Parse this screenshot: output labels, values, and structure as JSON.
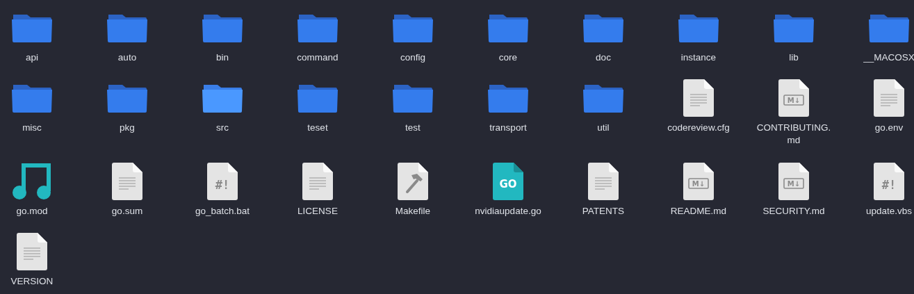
{
  "items": [
    {
      "name": "api",
      "kind": "folder",
      "selected": false
    },
    {
      "name": "auto",
      "kind": "folder",
      "selected": false
    },
    {
      "name": "bin",
      "kind": "folder",
      "selected": false
    },
    {
      "name": "command",
      "kind": "folder",
      "selected": false
    },
    {
      "name": "config",
      "kind": "folder",
      "selected": false
    },
    {
      "name": "core",
      "kind": "folder",
      "selected": false
    },
    {
      "name": "doc",
      "kind": "folder",
      "selected": false
    },
    {
      "name": "instance",
      "kind": "folder",
      "selected": false
    },
    {
      "name": "lib",
      "kind": "folder",
      "selected": false
    },
    {
      "name": "__MACOSX",
      "kind": "folder",
      "selected": false
    },
    {
      "name": "misc",
      "kind": "folder",
      "selected": false
    },
    {
      "name": "pkg",
      "kind": "folder",
      "selected": false
    },
    {
      "name": "src",
      "kind": "folder",
      "selected": true
    },
    {
      "name": "teset",
      "kind": "folder",
      "selected": false
    },
    {
      "name": "test",
      "kind": "folder",
      "selected": false
    },
    {
      "name": "transport",
      "kind": "folder",
      "selected": false
    },
    {
      "name": "util",
      "kind": "folder",
      "selected": false
    },
    {
      "name": "codereview.cfg",
      "kind": "text",
      "selected": false
    },
    {
      "name": "CONTRIBUTING.md",
      "kind": "markdown",
      "glyph": "M↓",
      "selected": false
    },
    {
      "name": "go.env",
      "kind": "text",
      "selected": false
    },
    {
      "name": "go.mod",
      "kind": "music",
      "selected": false
    },
    {
      "name": "go.sum",
      "kind": "text",
      "selected": false
    },
    {
      "name": "go_batch.bat",
      "kind": "script",
      "glyph": "#!",
      "selected": false
    },
    {
      "name": "LICENSE",
      "kind": "text",
      "selected": false
    },
    {
      "name": "Makefile",
      "kind": "make",
      "selected": false
    },
    {
      "name": "nvidiaupdate.go",
      "kind": "go",
      "glyph": "GO",
      "selected": false
    },
    {
      "name": "PATENTS",
      "kind": "text",
      "selected": false
    },
    {
      "name": "README.md",
      "kind": "markdown",
      "glyph": "M↓",
      "selected": false
    },
    {
      "name": "SECURITY.md",
      "kind": "markdown",
      "glyph": "M↓",
      "selected": false
    },
    {
      "name": "update.vbs",
      "kind": "script",
      "glyph": "#!",
      "selected": false
    },
    {
      "name": "VERSION",
      "kind": "text",
      "selected": false
    }
  ]
}
